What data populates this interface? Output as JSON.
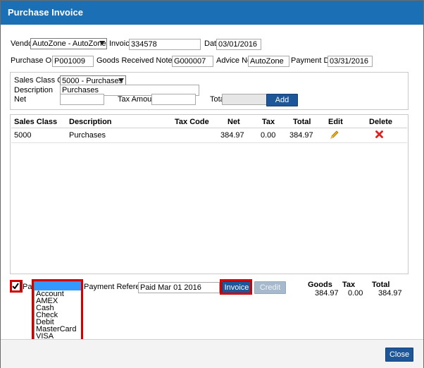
{
  "window": {
    "title": "Purchase Invoice"
  },
  "header": {
    "vendor_label": "Vendor",
    "vendor_value": "AutoZone - AutoZone",
    "invoice_label": "Invoice",
    "invoice_value": "334578",
    "date_label": "Date",
    "date_value": "03/01/2016",
    "po_label": "Purchase Order",
    "po_value": "P001009",
    "grn_label": "Goods Received Note (GRN)",
    "grn_value": "G000007",
    "advice_label": "Advice Note",
    "advice_value": "AutoZone",
    "due_label": "Payment Due",
    "due_value": "03/31/2016"
  },
  "line_entry": {
    "sales_class_label": "Sales Class Code",
    "sales_class_value": "5000 - Purchases",
    "description_label": "Description",
    "description_value": "Purchases",
    "net_label": "Net",
    "net_value": "",
    "tax_label": "Tax Amount",
    "tax_value": "",
    "total_label": "Total",
    "total_value": "",
    "add_label": "Add"
  },
  "grid": {
    "columns": [
      "Sales Class",
      "Description",
      "Tax Code",
      "Net",
      "Tax",
      "Total",
      "Edit",
      "Delete"
    ],
    "rows": [
      {
        "sales_class": "5000",
        "description": "Purchases",
        "tax_code": "",
        "net": "384.97",
        "tax": "0.00",
        "total": "384.97"
      }
    ]
  },
  "payment": {
    "paid_label": "Paid",
    "paid_checked": true,
    "method_options": [
      "",
      "Account",
      "AMEX",
      "Cash",
      "Check",
      "Debit",
      "MasterCard",
      "VISA"
    ],
    "reference_label": "Payment Reference",
    "reference_value": "Paid Mar 01 2016",
    "invoice_button": "Invoice",
    "credit_button": "Credit"
  },
  "totals": {
    "goods_label": "Goods",
    "tax_label": "Tax",
    "total_label": "Total",
    "goods_value": "384.97",
    "tax_value": "0.00",
    "total_value": "384.97"
  },
  "footer": {
    "close_label": "Close"
  },
  "colors": {
    "title_bar": "#1a6fb5",
    "button": "#1e5799",
    "highlight": "#d40000"
  }
}
